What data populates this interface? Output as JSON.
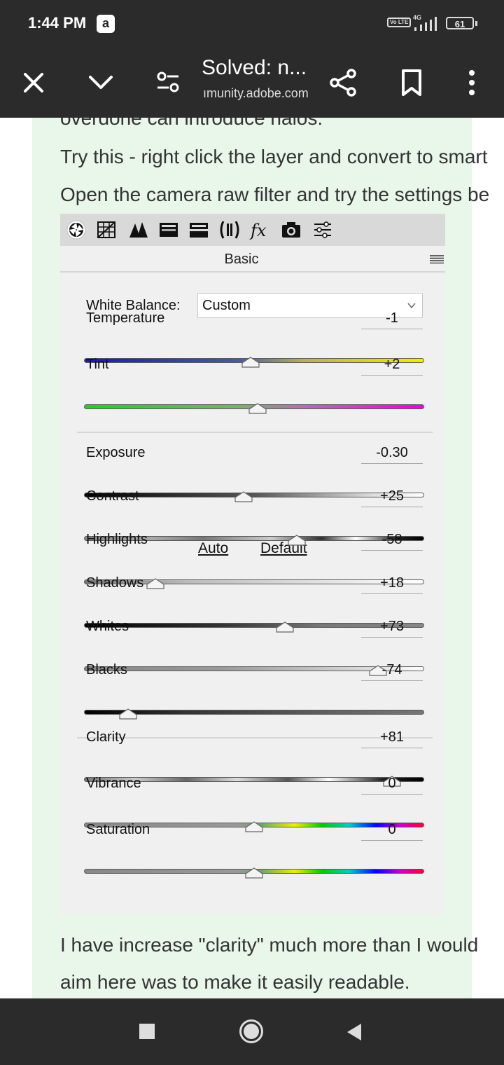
{
  "status_bar": {
    "time": "1:44 PM",
    "app_badge": "a",
    "volte": "Vo LTE",
    "network": "4G",
    "battery": "61"
  },
  "browser": {
    "title": "Solved: n...",
    "url": "ımunity.adobe.com"
  },
  "post": {
    "line_top": "overdone can introduce halos.",
    "line_1": "Try this - right click the layer and convert to smart",
    "line_2": "Open the camera raw filter and try the settings be",
    "line_3": "I have increase \"clarity\" much more than I would",
    "line_4": "aim here was to make it easily readable."
  },
  "camera_raw": {
    "tab_icons": [
      "basic-icon",
      "tone-curve-icon",
      "detail-icon",
      "hsl-icon",
      "split-toning-icon",
      "lens-corrections-icon",
      "fx-icon",
      "camera-calibration-icon",
      "presets-icon"
    ],
    "panel_title": "Basic",
    "white_balance_label": "White Balance:",
    "white_balance_value": "Custom",
    "auto_label": "Auto",
    "default_label": "Default",
    "sliders": [
      {
        "label": "Temperature",
        "value": "-1",
        "position": 0.49
      },
      {
        "label": "Tint",
        "value": "+2",
        "position": 0.51
      },
      {
        "label": "Exposure",
        "value": "-0.30",
        "position": 0.47
      },
      {
        "label": "Contrast",
        "value": "+25",
        "position": 0.625
      },
      {
        "label": "Highlights",
        "value": "-58",
        "position": 0.21
      },
      {
        "label": "Shadows",
        "value": "+18",
        "position": 0.59
      },
      {
        "label": "Whites",
        "value": "+73",
        "position": 0.865
      },
      {
        "label": "Blacks",
        "value": "-74",
        "position": 0.13
      },
      {
        "label": "Clarity",
        "value": "+81",
        "position": 0.905
      },
      {
        "label": "Vibrance",
        "value": "0",
        "position": 0.5
      },
      {
        "label": "Saturation",
        "value": "0",
        "position": 0.5
      }
    ]
  },
  "colors": {
    "bar": "#2b2b2b",
    "reply_bg": "#e9f6ea",
    "panel_bg": "#f0f0f0",
    "tabs_bg": "#d9d9d9"
  }
}
